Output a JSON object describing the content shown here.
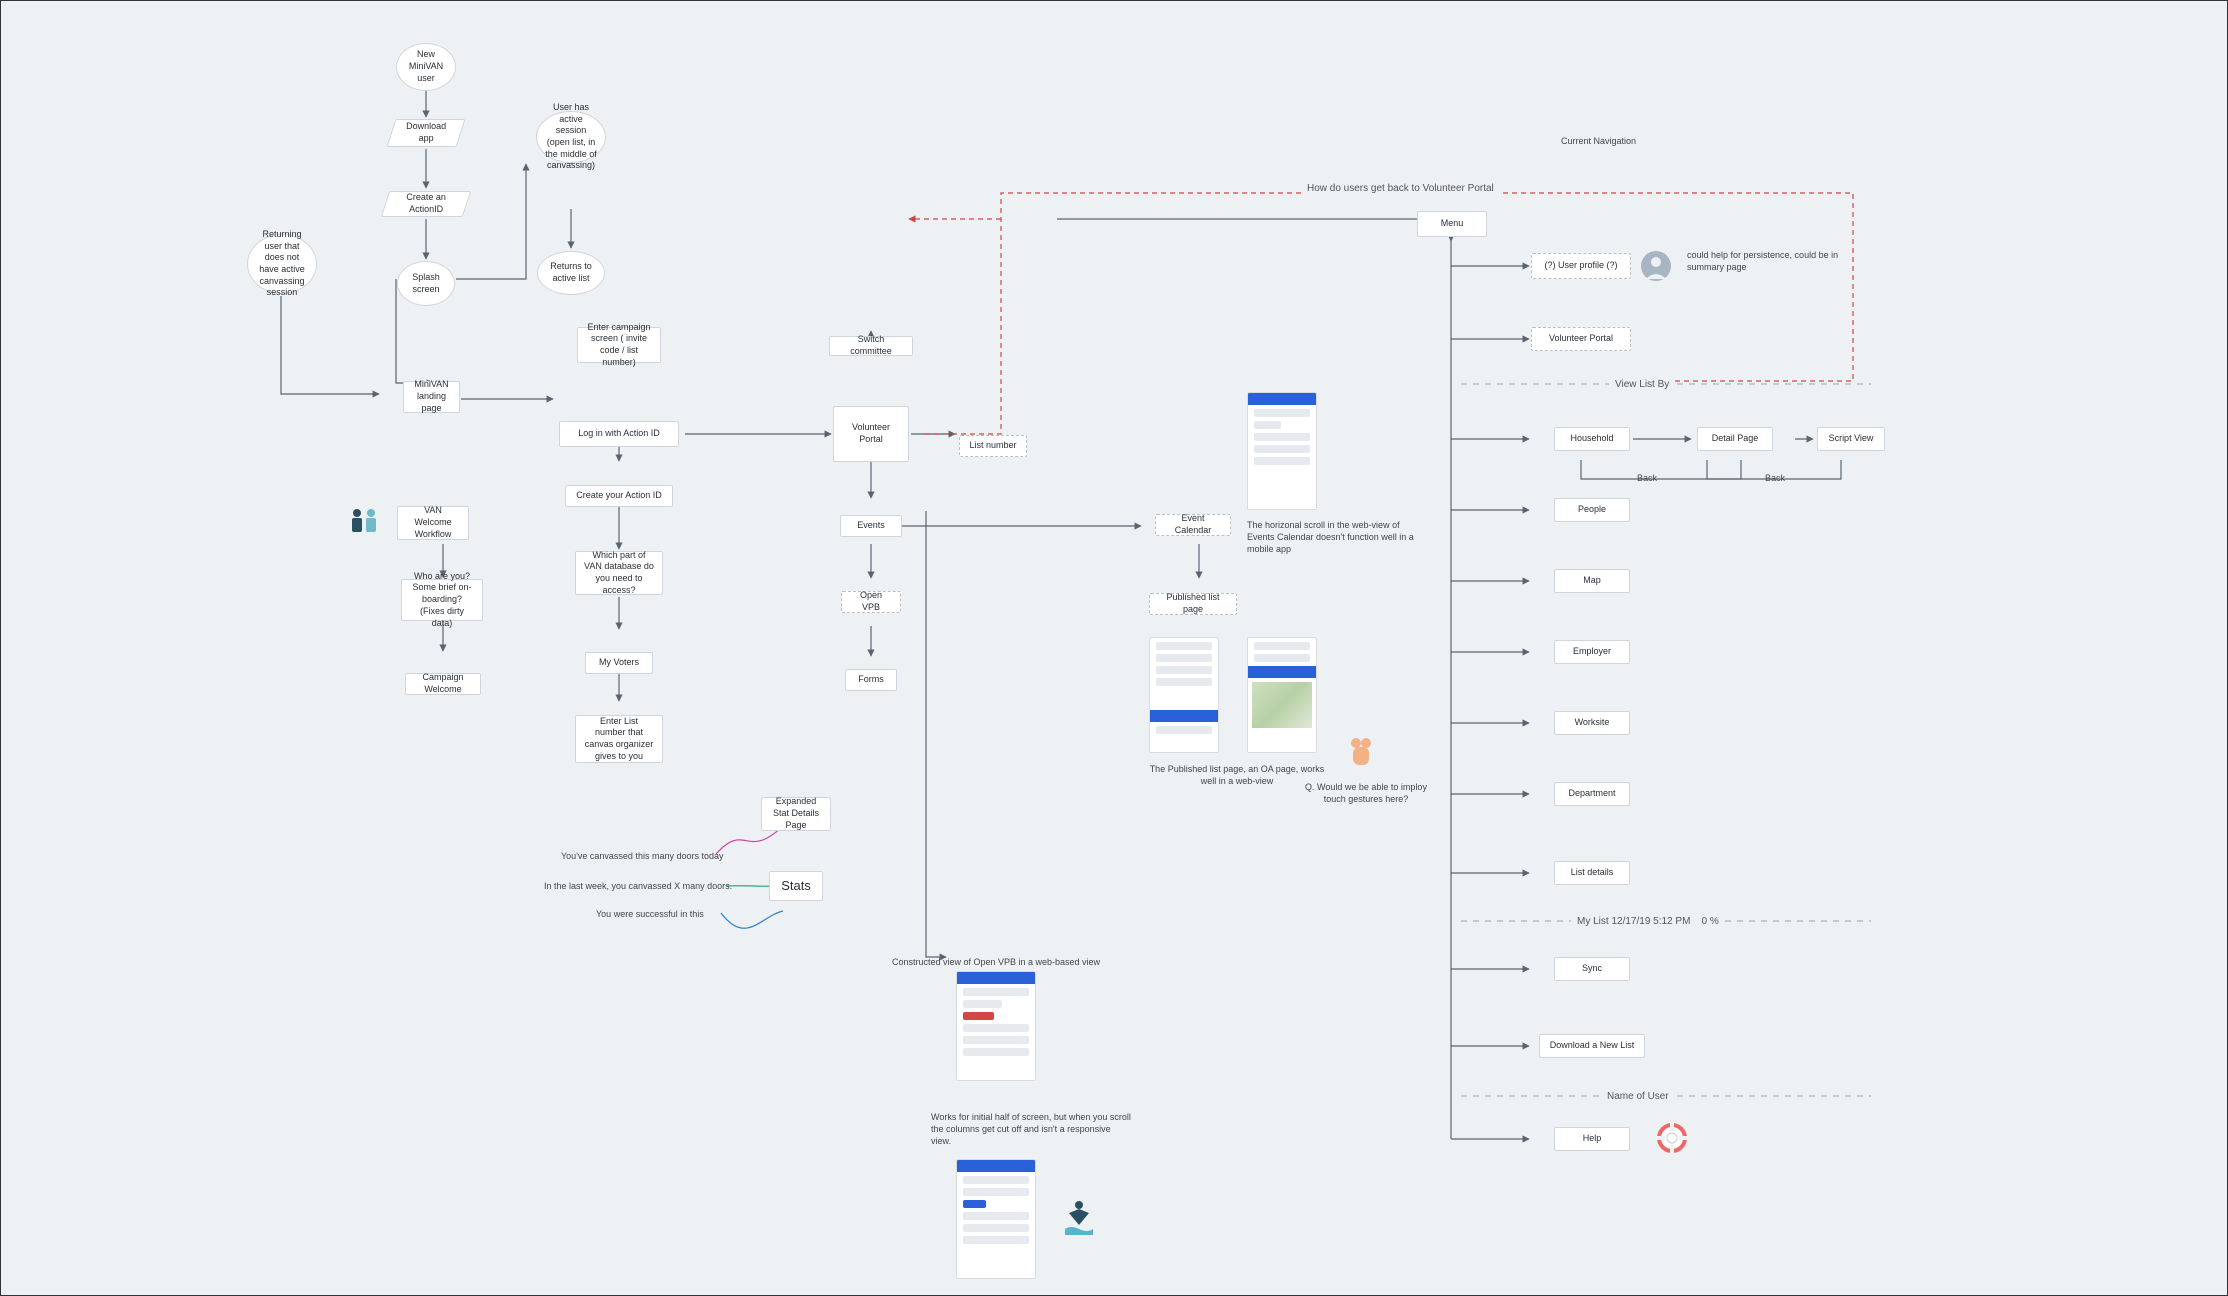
{
  "header": {
    "current_nav": "Current Navigation",
    "question": "How do users get back to Volunteer Portal"
  },
  "left": {
    "new_user": "New MiniVAN user",
    "download": "Download app",
    "create_actionid": "Create an ActionID",
    "splash": "Splash screen",
    "active_session": "User has active session (open list, in the middle of canvassing)",
    "returns_active": "Returns to active list",
    "returning_user": "Returning user that does not have active canvassing session",
    "minivan_landing": "MiniVAN landing page",
    "van_welcome": "VAN Welcome Workflow",
    "who_are_you": "Who are you? Some brief on-boarding? (Fixes dirty data)",
    "campaign_welcome": "Campaign Welcome"
  },
  "center": {
    "enter_campaign": "Enter campaign screen ( invite code / list number)",
    "login_action": "Log in with Action ID",
    "create_action": "Create your Action ID",
    "which_db": "Which part of VAN database do you need to access?",
    "my_voters": "My Voters",
    "enter_list": "Enter List number that canvas organizer gives to you",
    "switch_committee": "Switch committee",
    "volunteer_portal": "Volunteer Portal",
    "list_number": "List number",
    "events": "Events",
    "open_vpb": "Open VPB",
    "forms": "Forms",
    "expanded_stat": "Expanded Stat Details Page",
    "stats_node": "Stats",
    "stat1": "You've canvassed this many doors today",
    "stat2": "In the last week, you canvassed X many doors.",
    "stat3": "You were successful in this",
    "vpb_caption": "Constructed view of Open VPB in a web-based view",
    "vpb_note": "Works for initial half of screen, but when you scroll the columns get cut off and isn't a responsive view."
  },
  "events": {
    "event_calendar": "Event Calendar",
    "published_list": "Published list page",
    "note1": "The horizonal scroll in the web-view of Events Calendar doesn't function well in a mobile app",
    "note2": "The Published list page, an OA page, works well in a web-view",
    "gesture": "Q. Would we be able to imploy touch gestures here?"
  },
  "menu": {
    "menu": "Menu",
    "user_profile": "(?) User profile (?)",
    "profile_note": "could help for persistence, could be in summary page",
    "volunteer_portal": "Volunteer Portal",
    "divider1": "View List By",
    "household": "Household",
    "detail_page": "Detail Page",
    "script_view": "Script View",
    "back": "Back",
    "people": "People",
    "map": "Map",
    "employer": "Employer",
    "worksite": "Worksite",
    "department": "Department",
    "list_details": "List details",
    "divider2_a": "My List 12/17/19 5:12 PM",
    "divider2_b": "0 %",
    "sync": "Sync",
    "download_new": "Download a New List",
    "divider3": "Name of User",
    "help": "Help"
  }
}
